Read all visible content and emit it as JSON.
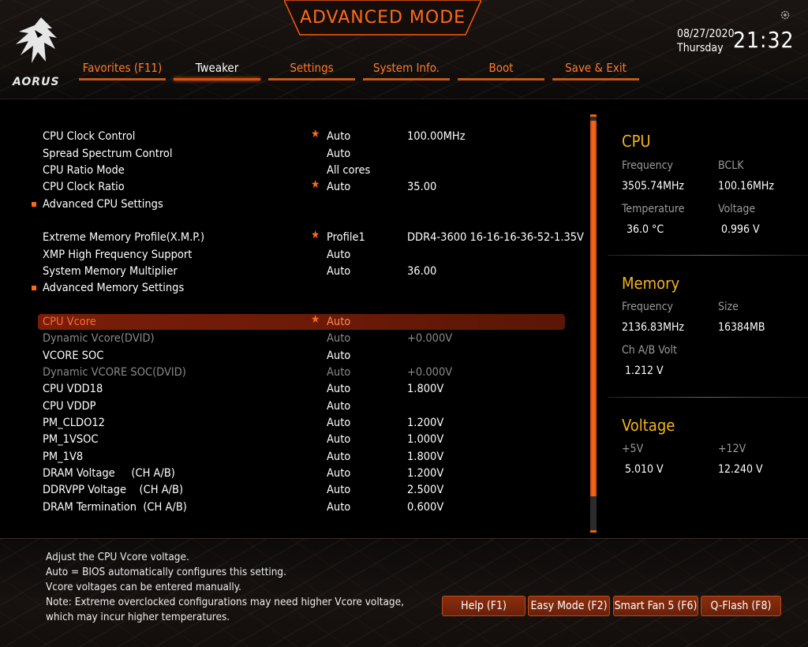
{
  "header": {
    "title": "ADVANCED MODE",
    "logo_text": "AORUS",
    "date": "08/27/2020",
    "day": "Thursday",
    "time": "21:32"
  },
  "tabs": [
    {
      "label": "Favorites (F11)"
    },
    {
      "label": "Tweaker",
      "active": true
    },
    {
      "label": "Settings"
    },
    {
      "label": "System Info."
    },
    {
      "label": "Boot"
    },
    {
      "label": "Save & Exit"
    }
  ],
  "settings": [
    {
      "name": "CPU Clock Control",
      "star": "★",
      "value1": "Auto",
      "value2": "100.00MHz"
    },
    {
      "name": "Spread Spectrum Control",
      "star": "",
      "value1": "Auto",
      "value2": ""
    },
    {
      "name": "CPU Ratio Mode",
      "star": "",
      "value1": "All cores",
      "value2": ""
    },
    {
      "name": "CPU Clock Ratio",
      "star": "★",
      "value1": "Auto",
      "value2": "35.00"
    },
    {
      "name": "Advanced CPU Settings",
      "submenu": true
    },
    {
      "name": "Extreme Memory Profile(X.M.P.)",
      "star": "★",
      "value1": "Profile1",
      "value2": "DDR4-3600 16-16-16-36-52-1.35V"
    },
    {
      "name": "XMP High Frequency Support",
      "star": "",
      "value1": "Auto",
      "value2": ""
    },
    {
      "name": "System Memory Multiplier",
      "star": "",
      "value1": "Auto",
      "value2": "36.00"
    },
    {
      "name": "Advanced Memory Settings",
      "submenu": true
    },
    {
      "name": "CPU Vcore",
      "star": "★",
      "value1": "Auto",
      "value2": "",
      "selected": true
    },
    {
      "name": "Dynamic Vcore(DVID)",
      "star": "",
      "value1": "Auto",
      "value2": "+0.000V",
      "dim": true
    },
    {
      "name": "VCORE SOC",
      "star": "",
      "value1": "Auto",
      "value2": ""
    },
    {
      "name": "Dynamic VCORE SOC(DVID)",
      "star": "",
      "value1": "Auto",
      "value2": "+0.000V",
      "dim": true
    },
    {
      "name": "CPU VDD18",
      "star": "",
      "value1": "Auto",
      "value2": "1.800V"
    },
    {
      "name": "CPU VDDP",
      "star": "",
      "value1": "Auto",
      "value2": ""
    },
    {
      "name": "PM_CLDO12",
      "star": "",
      "value1": "Auto",
      "value2": "1.200V"
    },
    {
      "name": "PM_1VSOC",
      "star": "",
      "value1": "Auto",
      "value2": "1.000V"
    },
    {
      "name": "PM_1V8",
      "star": "",
      "value1": "Auto",
      "value2": "1.800V"
    },
    {
      "name": "DRAM Voltage     (CH A/B)",
      "star": "",
      "value1": "Auto",
      "value2": "1.200V"
    },
    {
      "name": "DDRVPP Voltage    (CH A/B)",
      "star": "",
      "value1": "Auto",
      "value2": "2.500V"
    },
    {
      "name": "DRAM Termination  (CH A/B)",
      "star": "",
      "value1": "Auto",
      "value2": "0.600V"
    }
  ],
  "panel": {
    "cpu": {
      "title": "CPU",
      "frequency_label": "Frequency",
      "frequency": "3505.74MHz",
      "bclk_label": "BCLK",
      "bclk": "100.16MHz",
      "temperature_label": "Temperature",
      "temperature": "36.0 °C",
      "voltage_label": "Voltage",
      "voltage": "0.996 V"
    },
    "memory": {
      "title": "Memory",
      "frequency_label": "Frequency",
      "frequency": "2136.83MHz",
      "size_label": "Size",
      "size": "16384MB",
      "volt_label": "Ch A/B Volt",
      "volt": "1.212 V"
    },
    "voltage": {
      "title": "Voltage",
      "p5v_label": "+5V",
      "p5v": "5.010 V",
      "p12v_label": "+12V",
      "p12v": "12.240 V"
    }
  },
  "help_text": [
    "Adjust the CPU Vcore voltage.",
    "Auto = BIOS automatically configures this setting.",
    "Vcore voltages can be entered manually.",
    "Note: Extreme overclocked configurations may need higher Vcore voltage,",
    "which may incur higher temperatures."
  ],
  "footer_buttons": [
    {
      "label": "Help (F1)"
    },
    {
      "label": "Easy Mode (F2)"
    },
    {
      "label": "Smart Fan 5 (F6)"
    },
    {
      "label": "Q-Flash (F8)"
    }
  ],
  "colors": {
    "accent": "#ff6a1a",
    "gold": "#f4b41a",
    "selected_row": "#7a1e08"
  }
}
